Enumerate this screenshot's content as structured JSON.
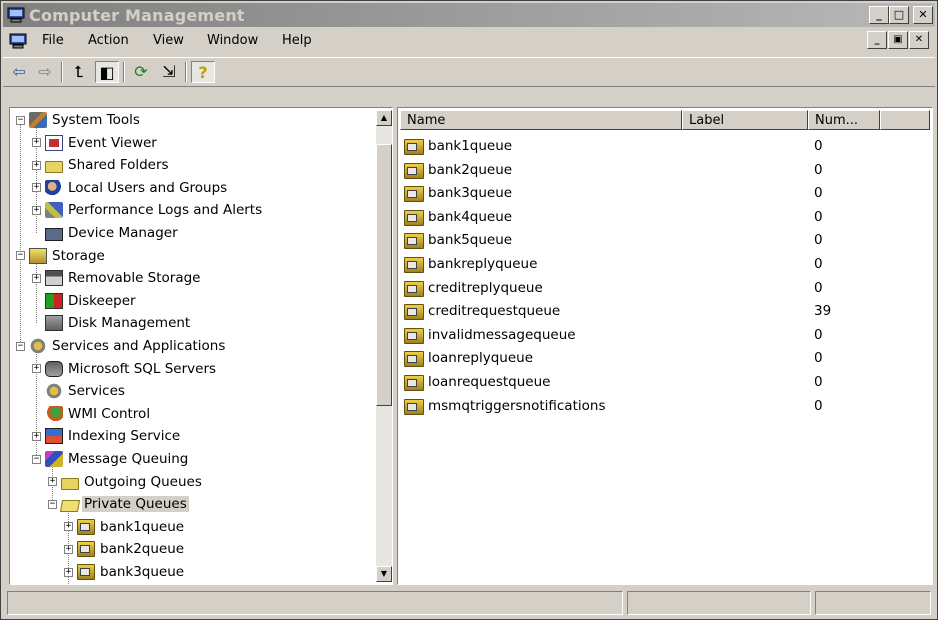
{
  "window": {
    "title": "Computer Management"
  },
  "menu": [
    "File",
    "Action",
    "View",
    "Window",
    "Help"
  ],
  "toolbar": [
    {
      "icon": "back-arrow-icon",
      "glyph": "⇦"
    },
    {
      "icon": "forward-arrow-icon",
      "glyph": "⇨"
    },
    {
      "icon": "up-one-level-icon",
      "glyph": "⮤"
    },
    {
      "icon": "show-hide-tree-icon",
      "glyph": "◧"
    },
    {
      "icon": "refresh-icon",
      "glyph": "⟳"
    },
    {
      "icon": "export-list-icon",
      "glyph": "⇲"
    },
    {
      "icon": "help-icon",
      "glyph": "?"
    }
  ],
  "tree": [
    {
      "label": "System Tools",
      "level": 0,
      "expander": "-",
      "icon": "i-tools"
    },
    {
      "label": "Event Viewer",
      "level": 1,
      "expander": "+",
      "icon": "i-event"
    },
    {
      "label": "Shared Folders",
      "level": 1,
      "expander": "+",
      "icon": "i-folder"
    },
    {
      "label": "Local Users and Groups",
      "level": 1,
      "expander": "+",
      "icon": "i-users"
    },
    {
      "label": "Performance Logs and Alerts",
      "level": 1,
      "expander": "+",
      "icon": "i-perf"
    },
    {
      "label": "Device Manager",
      "level": 1,
      "expander": "",
      "icon": "i-device"
    },
    {
      "label": "Storage",
      "level": 0,
      "expander": "-",
      "icon": "i-storage"
    },
    {
      "label": "Removable Storage",
      "level": 1,
      "expander": "+",
      "icon": "i-removable"
    },
    {
      "label": "Diskeeper",
      "level": 1,
      "expander": "",
      "icon": "i-diskeeper"
    },
    {
      "label": "Disk Management",
      "level": 1,
      "expander": "",
      "icon": "i-diskmgmt"
    },
    {
      "label": "Services and Applications",
      "level": 0,
      "expander": "-",
      "icon": "i-services"
    },
    {
      "label": "Microsoft SQL Servers",
      "level": 1,
      "expander": "+",
      "icon": "i-sql"
    },
    {
      "label": "Services",
      "level": 1,
      "expander": "",
      "icon": "i-services"
    },
    {
      "label": "WMI Control",
      "level": 1,
      "expander": "",
      "icon": "i-wmi"
    },
    {
      "label": "Indexing Service",
      "level": 1,
      "expander": "+",
      "icon": "i-index"
    },
    {
      "label": "Message Queuing",
      "level": 1,
      "expander": "-",
      "icon": "i-mq"
    },
    {
      "label": "Outgoing Queues",
      "level": 2,
      "expander": "+",
      "icon": "i-folder"
    },
    {
      "label": "Private Queues",
      "level": 2,
      "expander": "-",
      "icon": "i-openfolder",
      "selected": true
    },
    {
      "label": "bank1queue",
      "level": 3,
      "expander": "+",
      "icon": "i-queue"
    },
    {
      "label": "bank2queue",
      "level": 3,
      "expander": "+",
      "icon": "i-queue"
    },
    {
      "label": "bank3queue",
      "level": 3,
      "expander": "+",
      "icon": "i-queue"
    }
  ],
  "list": {
    "columns": [
      "Name",
      "Label",
      "Num..."
    ],
    "rows": [
      {
        "name": "bank1queue",
        "num": "0"
      },
      {
        "name": "bank2queue",
        "num": "0"
      },
      {
        "name": "bank3queue",
        "num": "0"
      },
      {
        "name": "bank4queue",
        "num": "0"
      },
      {
        "name": "bank5queue",
        "num": "0"
      },
      {
        "name": "bankreplyqueue",
        "num": "0"
      },
      {
        "name": "creditreplyqueue",
        "num": "0"
      },
      {
        "name": "creditrequestqueue",
        "num": "39"
      },
      {
        "name": "invalidmessagequeue",
        "num": "0"
      },
      {
        "name": "loanreplyqueue",
        "num": "0"
      },
      {
        "name": "loanrequestqueue",
        "num": "0"
      },
      {
        "name": "msmqtriggersnotifications",
        "num": "0"
      }
    ]
  },
  "colors": {
    "titlebar_inactive": "#808080",
    "face": "#d4d0c8",
    "pane": "#ffffff"
  }
}
